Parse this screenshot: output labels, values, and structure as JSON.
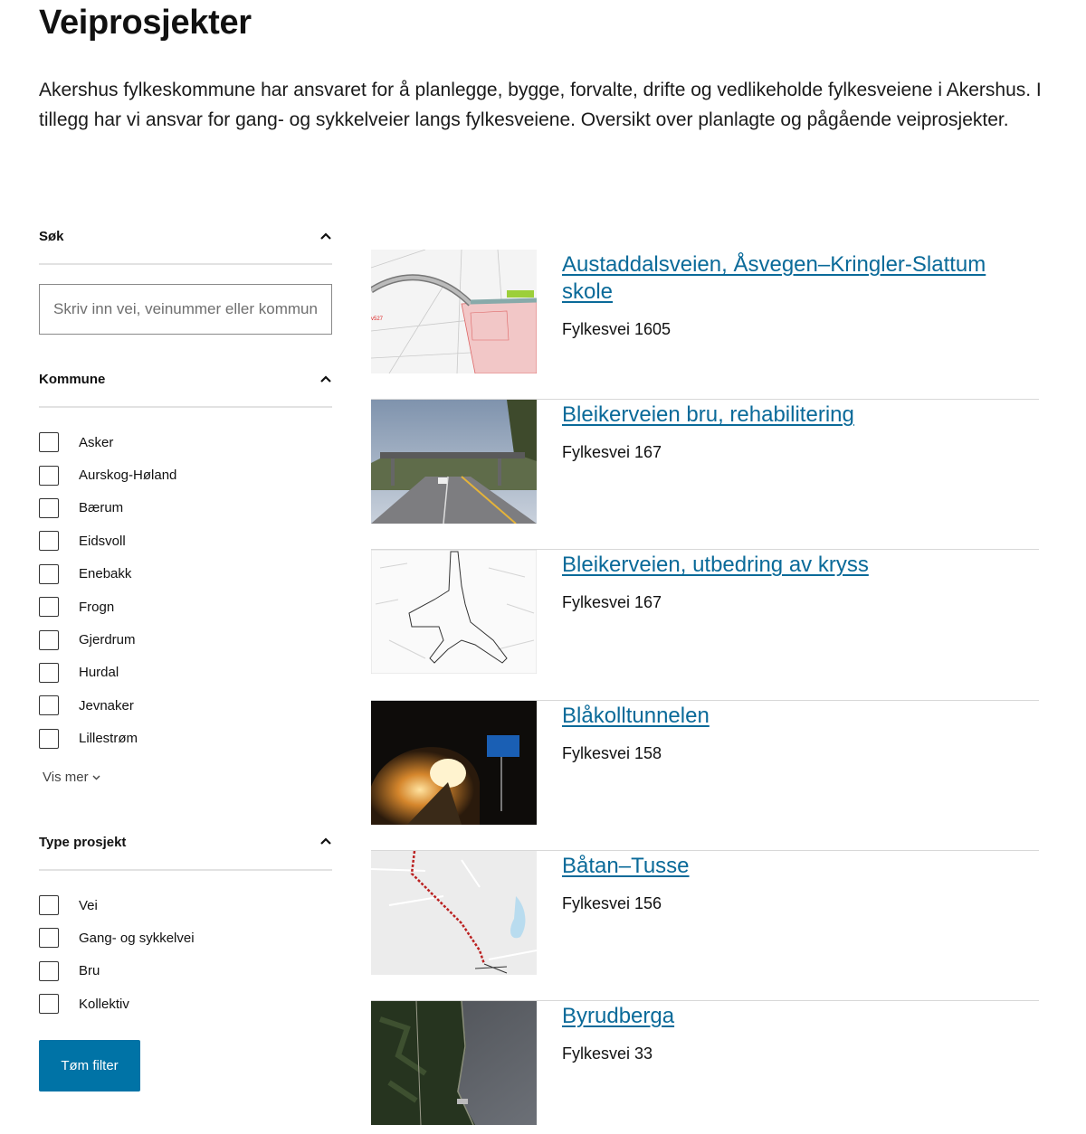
{
  "page": {
    "title": "Veiprosjekter",
    "intro": "Akershus fylkeskommune har ansvaret for å planlegge, bygge, forvalte, drifte og vedlikeholde fylkesveiene i Akershus. I tillegg har vi ansvar for gang- og sykkelveier langs fylkesveiene. Oversikt over planlagte og pågående veiprosjekter."
  },
  "filters": {
    "search": {
      "heading": "Søk",
      "placeholder": "Skriv inn vei, veinummer eller kommune",
      "value": ""
    },
    "kommune": {
      "heading": "Kommune",
      "options": [
        "Asker",
        "Aurskog-Høland",
        "Bærum",
        "Eidsvoll",
        "Enebakk",
        "Frogn",
        "Gjerdrum",
        "Hurdal",
        "Jevnaker",
        "Lillestrøm"
      ],
      "show_more_label": "Vis mer"
    },
    "type": {
      "heading": "Type prosjekt",
      "options": [
        "Vei",
        "Gang- og sykkelvei",
        "Bru",
        "Kollektiv"
      ]
    },
    "clear_button_label": "Tøm filter"
  },
  "projects": [
    {
      "title": "Austaddalsveien, Åsvegen–Kringler-Slattum skole",
      "subtitle": "Fylkesvei 1605",
      "image": "map-plan-drawing"
    },
    {
      "title": "Bleikerveien bru, rehabilitering",
      "subtitle": "Fylkesvei 167",
      "image": "photo-bridge-road"
    },
    {
      "title": "Bleikerveien, utbedring av kryss",
      "subtitle": "Fylkesvei 167",
      "image": "map-outline-drawing"
    },
    {
      "title": "Blåkolltunnelen",
      "subtitle": "Fylkesvei 158",
      "image": "photo-tunnel-night"
    },
    {
      "title": "Båtan–Tusse",
      "subtitle": "Fylkesvei 156",
      "image": "map-route"
    },
    {
      "title": "Byrudberga",
      "subtitle": "Fylkesvei 33",
      "image": "aerial-photo"
    }
  ],
  "colors": {
    "link": "#0a6a99",
    "button": "#0073a6",
    "divider": "#d8d8d8"
  }
}
